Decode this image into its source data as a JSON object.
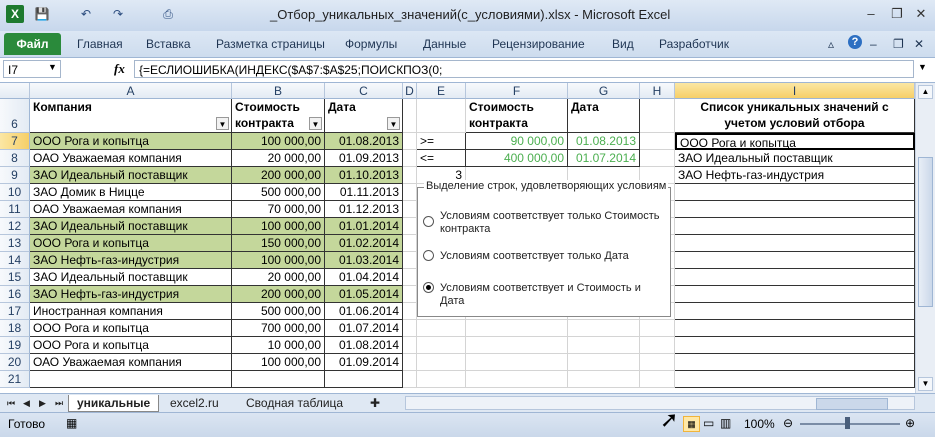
{
  "window": {
    "title": "_Отбор_уникальных_значений(с_условиями).xlsx  -  Microsoft Excel",
    "app_icon": "X"
  },
  "quick_access": {
    "save": "💾",
    "undo": "↶",
    "redo": "↷",
    "print": "⎙"
  },
  "ribbon": {
    "file": "Файл",
    "tabs": [
      "Главная",
      "Вставка",
      "Разметка страницы",
      "Формулы",
      "Данные",
      "Рецензирование",
      "Вид",
      "Разработчик"
    ],
    "help": "?"
  },
  "formula_bar": {
    "name_box": "I7",
    "fx": "fx",
    "formula": "{=ЕСЛИОШИБКА(ИНДЕКС($A$7:$A$25;ПОИСКПОЗ(0;"
  },
  "columns": [
    "A",
    "B",
    "C",
    "D",
    "E",
    "F",
    "G",
    "H",
    "I"
  ],
  "table": {
    "headers": {
      "company": "Компания",
      "cost": "Стоимость контракта",
      "date": "Дата"
    },
    "rows": [
      {
        "row": "7",
        "company": "ООО Рога и копытца",
        "cost": "100 000,00",
        "date": "01.08.2013",
        "hl": true
      },
      {
        "row": "8",
        "company": "ОАО Уважаемая компания",
        "cost": "20 000,00",
        "date": "01.09.2013",
        "hl": false
      },
      {
        "row": "9",
        "company": "ЗАО Идеальный поставщик",
        "cost": "200 000,00",
        "date": "01.10.2013",
        "hl": true
      },
      {
        "row": "10",
        "company": "ЗАО Домик в Ницце",
        "cost": "500 000,00",
        "date": "01.11.2013",
        "hl": false
      },
      {
        "row": "11",
        "company": "ОАО Уважаемая компания",
        "cost": "70 000,00",
        "date": "01.12.2013",
        "hl": false
      },
      {
        "row": "12",
        "company": "ЗАО Идеальный поставщик",
        "cost": "100 000,00",
        "date": "01.01.2014",
        "hl": true
      },
      {
        "row": "13",
        "company": "ООО Рога и копытца",
        "cost": "150 000,00",
        "date": "01.02.2014",
        "hl": true
      },
      {
        "row": "14",
        "company": "ЗАО Нефть-газ-индустрия",
        "cost": "100 000,00",
        "date": "01.03.2014",
        "hl": true
      },
      {
        "row": "15",
        "company": "ЗАО Идеальный поставщик",
        "cost": "20 000,00",
        "date": "01.04.2014",
        "hl": false
      },
      {
        "row": "16",
        "company": "ЗАО Нефть-газ-индустрия",
        "cost": "200 000,00",
        "date": "01.05.2014",
        "hl": true
      },
      {
        "row": "17",
        "company": "Иностранная компания",
        "cost": "500 000,00",
        "date": "01.06.2014",
        "hl": false
      },
      {
        "row": "18",
        "company": "ООО Рога и копытца",
        "cost": "700 000,00",
        "date": "01.07.2014",
        "hl": false
      },
      {
        "row": "19",
        "company": "ООО Рога и копытца",
        "cost": "10 000,00",
        "date": "01.08.2014",
        "hl": false
      },
      {
        "row": "20",
        "company": "ОАО Уважаемая компания",
        "cost": "100 000,00",
        "date": "01.09.2014",
        "hl": false
      },
      {
        "row": "21",
        "company": "",
        "cost": "",
        "date": "",
        "hl": false
      }
    ]
  },
  "criteria": {
    "header_cost": "Стоимость контракта",
    "header_date": "Дата",
    "rows": [
      {
        "op": ">=",
        "cost": "90 000,00",
        "date": "01.08.2013"
      },
      {
        "op": "<=",
        "cost": "400 000,00",
        "date": "01.07.2014"
      }
    ],
    "count": "3"
  },
  "unique_list": {
    "header": "Список уникальных значений с учетом условий отбора",
    "items": [
      "ООО Рога и копытца",
      "ЗАО Идеальный поставщик",
      "ЗАО Нефть-газ-индустрия"
    ]
  },
  "options": {
    "title": "Выделение строк, удовлетворяющих условиям",
    "items": [
      {
        "label": "Условиям соответствует только Стоимость контракта",
        "checked": false
      },
      {
        "label": "Условиям соответствует только Дата",
        "checked": false
      },
      {
        "label": "Условиям соответствует и Стоимость и Дата",
        "checked": true
      }
    ]
  },
  "sheets": {
    "tabs": [
      "уникальные",
      "excel2.ru",
      "Сводная таблица"
    ],
    "active": "уникальные"
  },
  "status": {
    "ready": "Готово",
    "zoom": "100%"
  },
  "colors": {
    "highlight": "#c4d79b",
    "green_text": "#4caf50",
    "file_tab": "#2a8a3b"
  }
}
